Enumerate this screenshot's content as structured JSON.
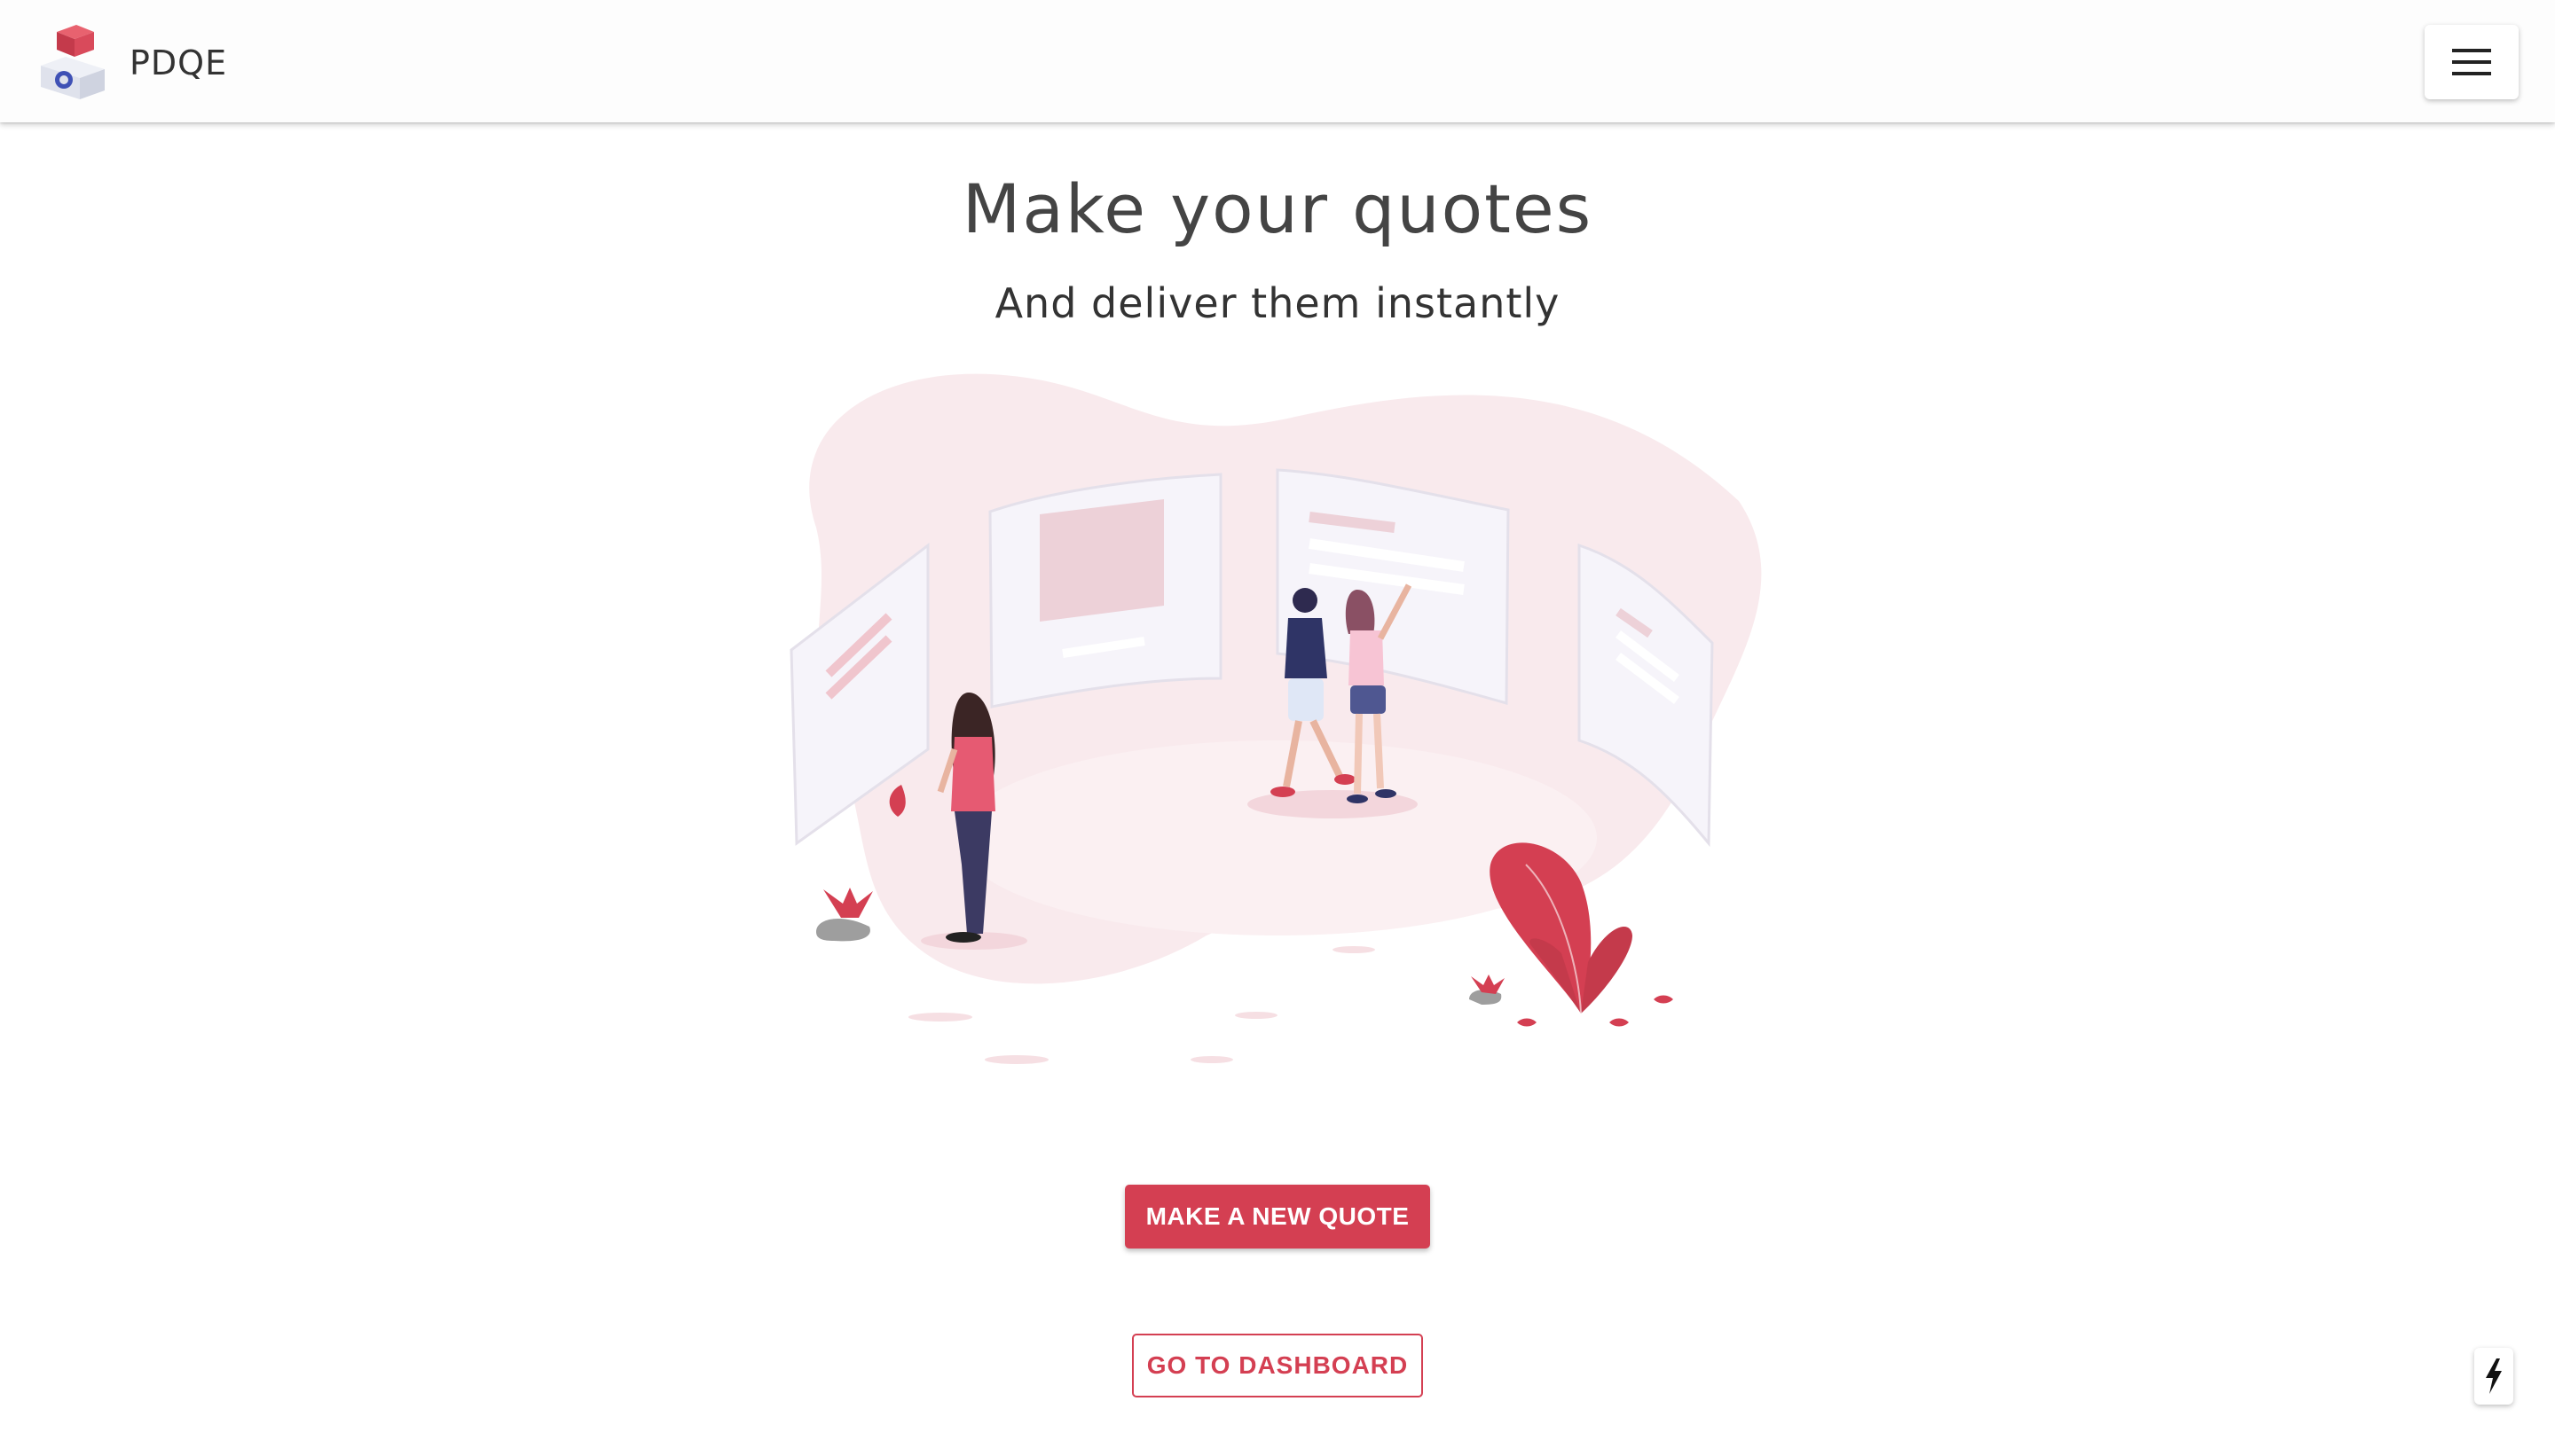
{
  "appbar": {
    "brand": "PDQE",
    "logo_icon": "box-logo-icon",
    "menu_icon": "hamburger-menu-icon"
  },
  "hero": {
    "title": "Make your quotes",
    "subtitle": "And deliver them instantly",
    "illustration": "people-viewing-display-boards-illustration"
  },
  "actions": {
    "primary_label": "MAKE A NEW QUOTE",
    "secondary_label": "GO TO DASHBOARD"
  },
  "floating": {
    "icon": "lightning-bolt-icon"
  },
  "colors": {
    "accent": "#d43f52",
    "blob": "#f9eaed",
    "panel": "#f6f4fa",
    "text": "#444444"
  }
}
